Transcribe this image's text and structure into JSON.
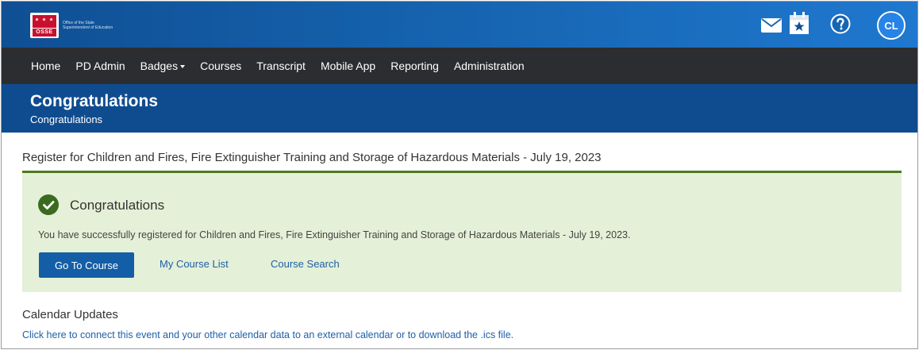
{
  "brand": {
    "logo_word": "OSSE",
    "logo_text": "Office of the State Superintendent of Education"
  },
  "top_icons": {
    "mail": "mail-icon",
    "calendar": "calendar-star-icon",
    "help": "help-icon"
  },
  "user": {
    "initials": "CL"
  },
  "nav": {
    "items": [
      {
        "label": "Home"
      },
      {
        "label": "PD Admin"
      },
      {
        "label": "Badges"
      },
      {
        "label": "Courses"
      },
      {
        "label": "Transcript"
      },
      {
        "label": "Mobile App"
      },
      {
        "label": "Reporting"
      },
      {
        "label": "Administration"
      }
    ]
  },
  "header": {
    "title": "Congratulations",
    "breadcrumb": "Congratulations"
  },
  "main": {
    "register_title": "Register for Children and Fires, Fire Extinguisher Training and Storage of Hazardous Materials - July 19, 2023",
    "success": {
      "title": "Congratulations",
      "message": "You have successfully registered for Children and Fires, Fire Extinguisher Training and Storage of Hazardous Materials - July 19, 2023.",
      "go_button": "Go To Course",
      "my_course_list": "My Course List",
      "course_search": "Course Search"
    },
    "calendar": {
      "heading": "Calendar Updates",
      "link": "Click here to connect this event and your other calendar data to an external calendar or to download the .ics file."
    }
  },
  "colors": {
    "topbar": "#1766b3",
    "navbar": "#2c2d30",
    "page_header": "#0f4c8f",
    "success_bg": "#e4f0d7",
    "success_rule": "#4c7a1e",
    "button": "#135ea6",
    "link": "#1f5fa8"
  }
}
